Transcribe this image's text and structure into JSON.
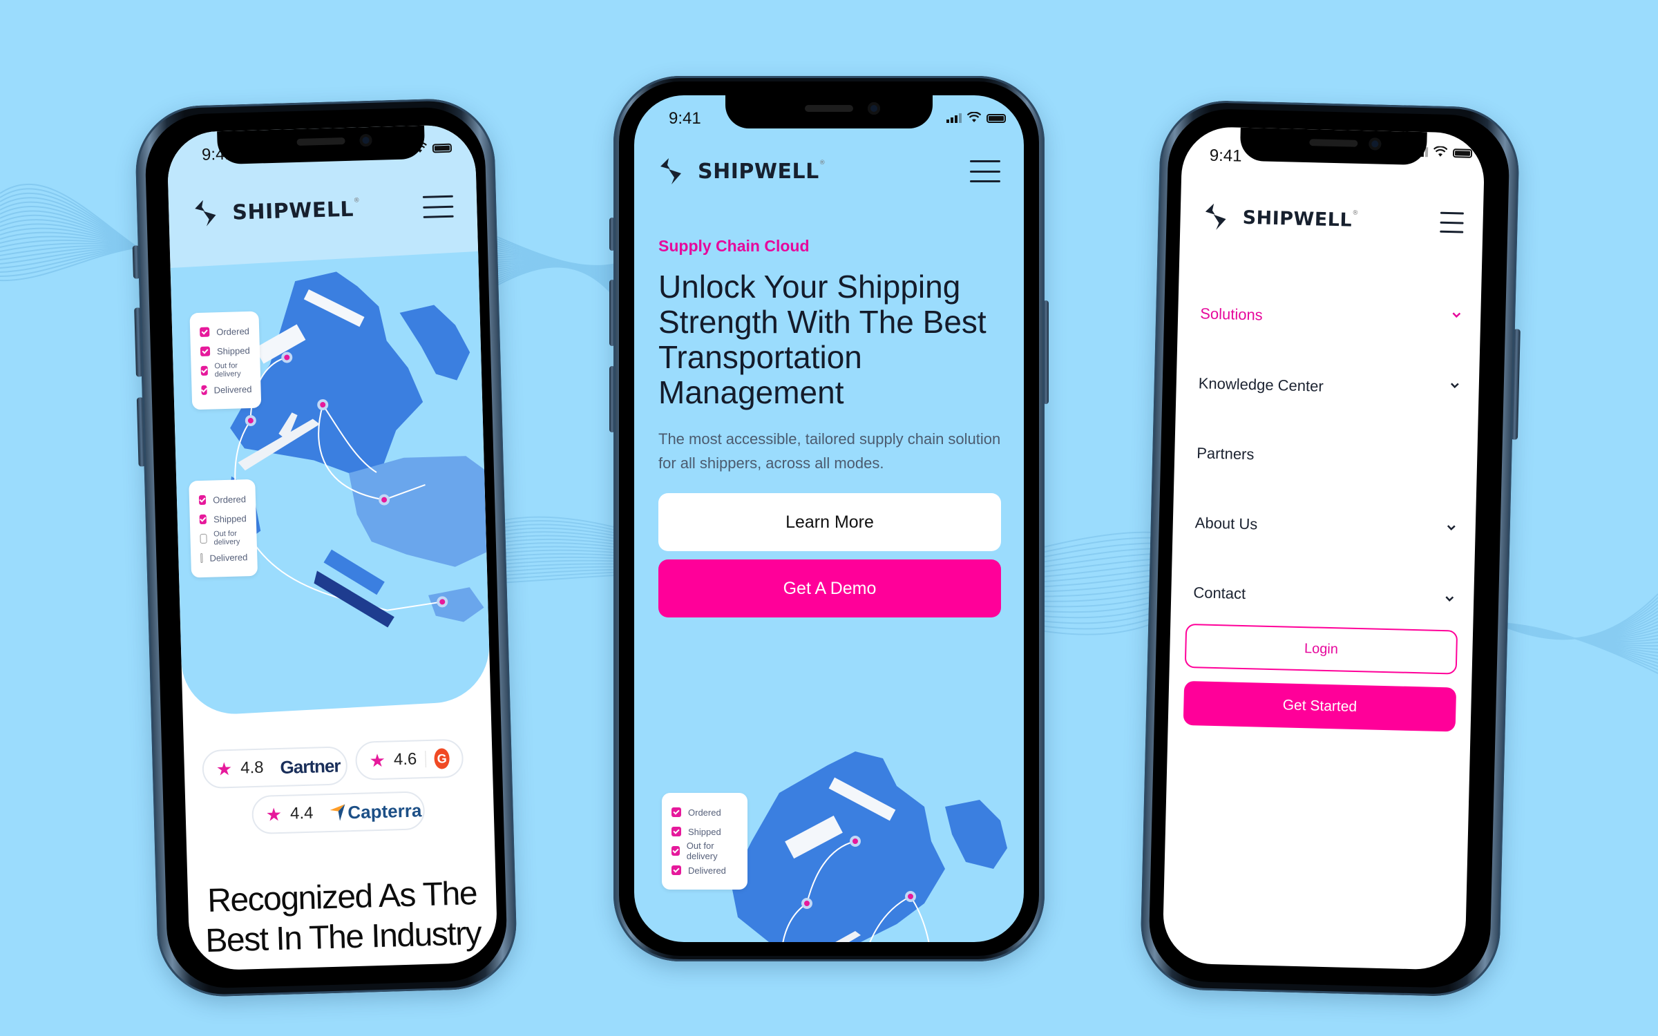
{
  "background_color": "#9bdcfd",
  "brand": {
    "name": "SHIPWELL",
    "registered_mark": "®",
    "accent_pink": "#ff0099",
    "text_dark": "#17202e"
  },
  "status_bar": {
    "time": "9:41",
    "icons": [
      "cellular-signal-icon",
      "wifi-icon",
      "battery-icon"
    ]
  },
  "phones": {
    "left": {
      "tracking_cards": [
        {
          "steps": [
            {
              "label": "Ordered",
              "checked": true
            },
            {
              "label": "Shipped",
              "checked": true
            },
            {
              "label": "Out for delivery",
              "checked": true
            },
            {
              "label": "Delivered",
              "checked": true
            }
          ]
        },
        {
          "steps": [
            {
              "label": "Ordered",
              "checked": true
            },
            {
              "label": "Shipped",
              "checked": true
            },
            {
              "label": "Out for delivery",
              "checked": false
            },
            {
              "label": "Delivered",
              "checked": false
            }
          ]
        }
      ],
      "ratings": [
        {
          "score": "4.8",
          "source": "Gartner"
        },
        {
          "score": "4.6",
          "source": "G2",
          "logo_glyph": "G"
        },
        {
          "score": "4.4",
          "source": "Capterra"
        }
      ],
      "heading": "Recognized As The Best In The Industry"
    },
    "middle": {
      "eyebrow": "Supply Chain Cloud",
      "title": "Unlock Your Shipping Strength With The Best Transportation Management",
      "subtitle": "The most accessible, tailored supply chain solution for all shippers, across all modes.",
      "buttons": {
        "secondary": "Learn More",
        "primary": "Get A Demo"
      },
      "tracking_card": {
        "steps": [
          {
            "label": "Ordered",
            "checked": true
          },
          {
            "label": "Shipped",
            "checked": true
          },
          {
            "label": "Out for delivery",
            "checked": true
          },
          {
            "label": "Delivered",
            "checked": true
          }
        ]
      }
    },
    "right": {
      "menu": [
        {
          "label": "Solutions",
          "active": true,
          "has_chevron": true
        },
        {
          "label": "Knowledge Center",
          "active": false,
          "has_chevron": true
        },
        {
          "label": "Partners",
          "active": false,
          "has_chevron": false
        },
        {
          "label": "About Us",
          "active": false,
          "has_chevron": true
        },
        {
          "label": "Contact",
          "active": false,
          "has_chevron": true
        }
      ],
      "buttons": {
        "login": "Login",
        "get_started": "Get Started"
      }
    }
  }
}
